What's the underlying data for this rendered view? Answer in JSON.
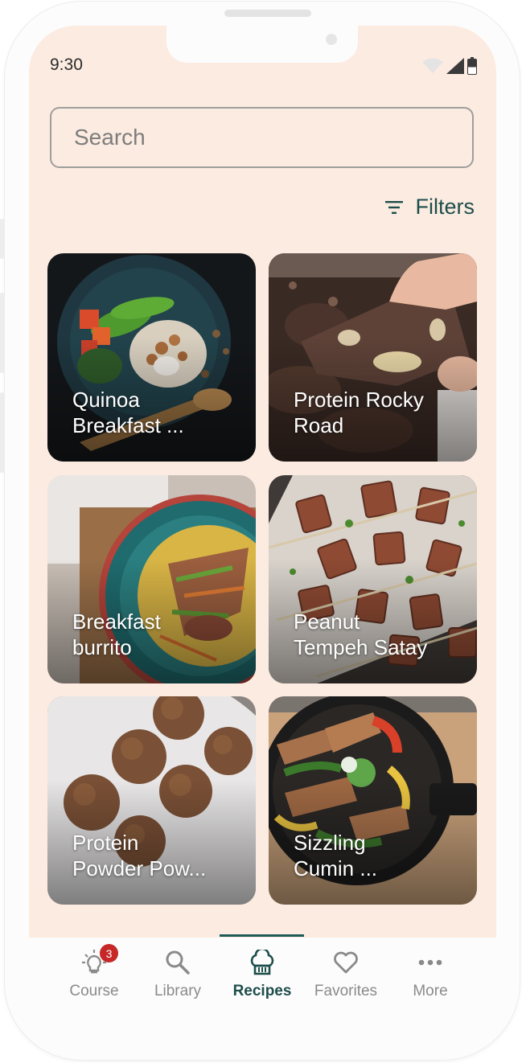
{
  "status_bar": {
    "time": "9:30"
  },
  "search": {
    "placeholder": "Search",
    "value": ""
  },
  "filters": {
    "label": "Filters"
  },
  "recipes": [
    {
      "title": "Quinoa\nBreakfast ..."
    },
    {
      "title": "Protein Rocky\nRoad"
    },
    {
      "title": "Breakfast\nburrito"
    },
    {
      "title": "Peanut\nTempeh Satay"
    },
    {
      "title": "Protein\nPowder Pow..."
    },
    {
      "title": "Sizzling\nCumin ..."
    }
  ],
  "nav": {
    "items": [
      {
        "label": "Course",
        "icon": "lightbulb-icon",
        "badge": "3"
      },
      {
        "label": "Library",
        "icon": "search-icon"
      },
      {
        "label": "Recipes",
        "icon": "chef-hat-icon",
        "active": true
      },
      {
        "label": "Favorites",
        "icon": "heart-icon"
      },
      {
        "label": "More",
        "icon": "more-dots-icon"
      }
    ]
  },
  "colors": {
    "screen_bg": "#fcebe0",
    "accent": "#1d4e4c",
    "badge": "#c62828",
    "inactive": "#8a8a8a"
  }
}
